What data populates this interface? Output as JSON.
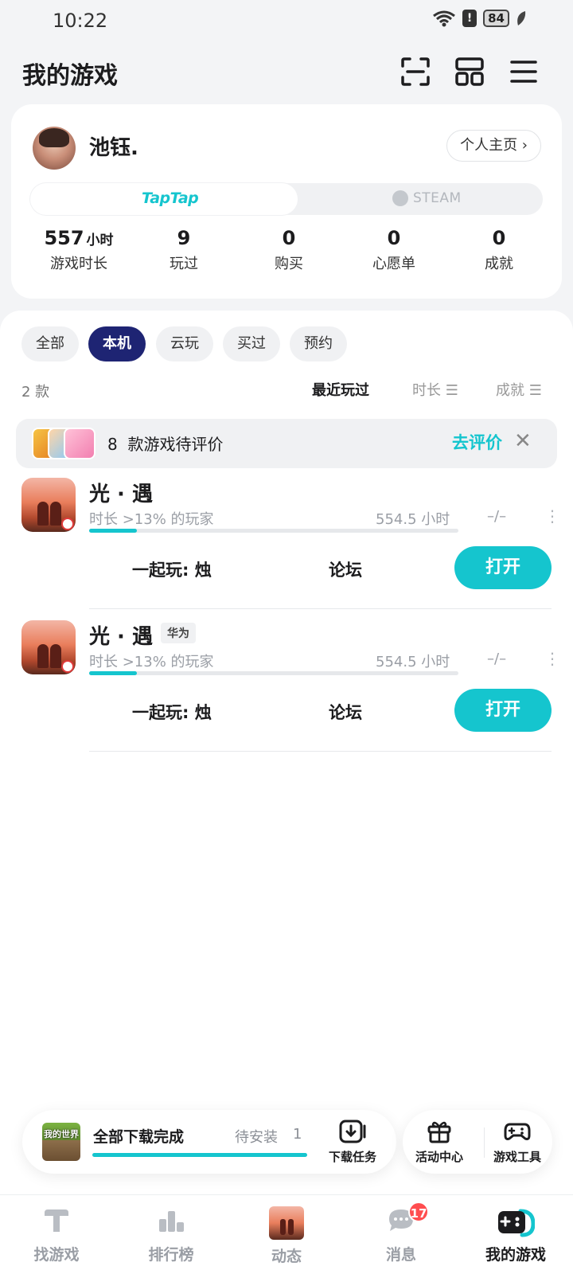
{
  "status_bar": {
    "time": "10:22",
    "battery": "84",
    "alert": "!"
  },
  "header": {
    "title": "我的游戏"
  },
  "profile": {
    "name": "池钰.",
    "homepage_label": "个人主页 ›",
    "platforms": [
      "TapTap",
      "STEAM"
    ],
    "stats": [
      {
        "value": "557",
        "unit": "小时",
        "label": "游戏时长"
      },
      {
        "value": "9",
        "unit": "",
        "label": "玩过"
      },
      {
        "value": "0",
        "unit": "",
        "label": "购买"
      },
      {
        "value": "0",
        "unit": "",
        "label": "心愿单"
      },
      {
        "value": "0",
        "unit": "",
        "label": "成就"
      }
    ]
  },
  "filters": {
    "chips": [
      "全部",
      "本机",
      "云玩",
      "买过",
      "预约"
    ],
    "active_chip": "本机",
    "count_label": "2  款",
    "sort_options": [
      "最近玩过",
      "时长 ☰",
      "成就 ☰"
    ]
  },
  "review_banner": {
    "count": "8",
    "text": "款游戏待评价",
    "action": "去评价",
    "close": "✕"
  },
  "games": [
    {
      "name": "光 · 遇",
      "tag": "",
      "stat": "时长  >13%  的玩家",
      "hours": "554.5  小时",
      "rating": "–/–",
      "more": "⋮",
      "progress": 0.13,
      "play_together": "一起玩:  烛",
      "forum": "论坛",
      "open": "打开"
    },
    {
      "name": "光 · 遇",
      "tag": "华为",
      "stat": "时长  >13%  的玩家",
      "hours": "554.5  小时",
      "rating": "–/–",
      "more": "⋮",
      "progress": 0.13,
      "play_together": "一起玩:  烛",
      "forum": "论坛",
      "open": "打开"
    }
  ],
  "download": {
    "thumb_text": "我的世界",
    "title": "全部下载完成",
    "pending_label": "待安装",
    "pending_count": "1",
    "task_label": "下载任务"
  },
  "tools": {
    "activity_label": "活动中心",
    "game_tools_label": "游戏工具"
  },
  "bottom_nav": [
    {
      "label": "找游戏",
      "icon": "taptap-icon"
    },
    {
      "label": "排行榜",
      "icon": "ranking-icon"
    },
    {
      "label": "动态",
      "icon": "game-avatar-icon"
    },
    {
      "label": "消息",
      "icon": "message-icon",
      "badge": "17"
    },
    {
      "label": "我的游戏",
      "icon": "gamepad-icon"
    }
  ],
  "colors": {
    "accent": "#15c5ce",
    "active_chip": "#1e2473",
    "badge": "#ff4d4f"
  }
}
